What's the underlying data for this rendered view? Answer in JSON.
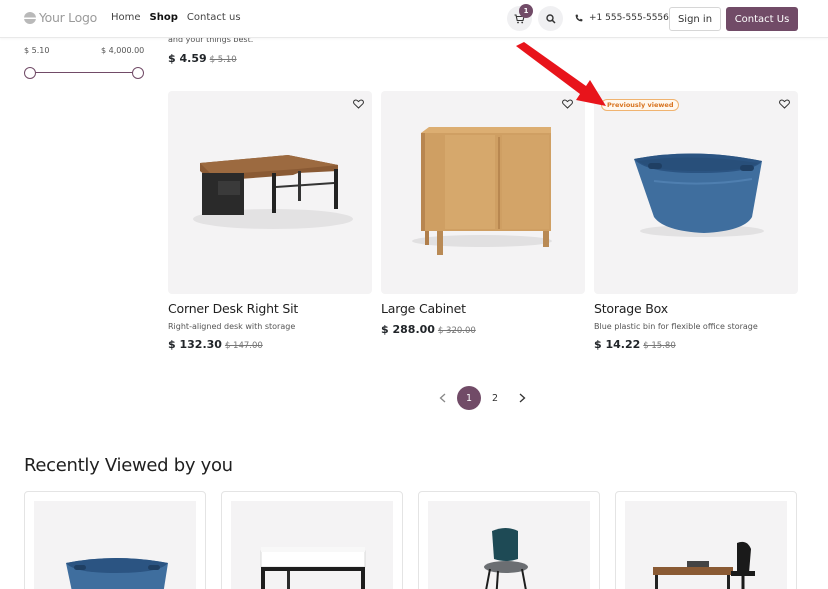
{
  "header": {
    "logo_text": "Your Logo",
    "nav": [
      "Home",
      "Shop",
      "Contact us"
    ],
    "active_nav": "Shop",
    "cart_count": "1",
    "phone": "+1 555-555-5556",
    "sign_in_label": "Sign in",
    "contact_label": "Contact Us"
  },
  "price_filter": {
    "min_label": "$ 5.10",
    "max_label": "$ 4,000.00",
    "min_value": 5.1,
    "max_value": 4000.0
  },
  "previous_row": {
    "desc_tail": "and your things best.",
    "price": "$ 4.59",
    "old_price": "$ 5.10"
  },
  "products": [
    {
      "name": "Corner Desk Right Sit",
      "desc": "Right-aligned desk with storage",
      "price": "$ 132.30",
      "old_price": "$ 147.00",
      "badge": ""
    },
    {
      "name": "Large Cabinet",
      "desc": "",
      "price": "$ 288.00",
      "old_price": "$ 320.00",
      "badge": ""
    },
    {
      "name": "Storage Box",
      "desc": "Blue plastic bin for flexible office storage",
      "price": "$ 14.22",
      "old_price": "$ 15.80",
      "badge": "Previously viewed"
    }
  ],
  "pagination": {
    "pages": [
      "1",
      "2"
    ],
    "current": "1"
  },
  "recently_viewed": {
    "title": "Recently Viewed by you",
    "items": [
      "storage-box",
      "white-desk",
      "chair",
      "office-desk"
    ]
  },
  "colors": {
    "brand": "#714b67",
    "badge_orange": "#d8731f",
    "arrow_red": "#e8141b"
  }
}
